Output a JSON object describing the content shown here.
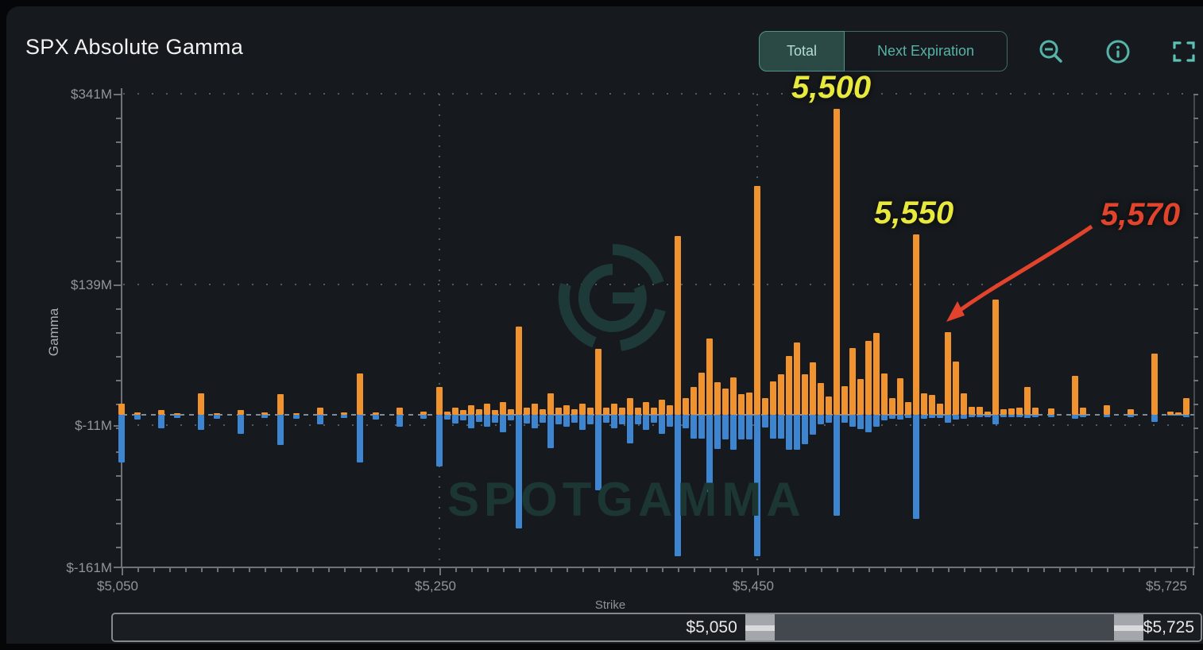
{
  "header": {
    "title": "SPX Absolute Gamma",
    "buttons": [
      {
        "label": "Total",
        "active": true
      },
      {
        "label": "Next Expiration",
        "active": false
      }
    ],
    "icons": [
      "zoom-out-icon",
      "info-icon",
      "fullscreen-icon"
    ],
    "accent_color": "#57b3a7"
  },
  "chart_data": {
    "type": "bar",
    "title": "SPX Absolute Gamma",
    "xlabel": "Strike",
    "ylabel": "Gamma",
    "xlim": [
      5050,
      5725
    ],
    "ylim": [
      -161,
      341
    ],
    "y_ticks": [
      "$341M",
      "$139M",
      "$-11M",
      "$-161M"
    ],
    "y_tick_values": [
      341,
      139,
      -11,
      -161
    ],
    "x_ticks": [
      "$5,050",
      "$5,250",
      "$5,450",
      "$5,725"
    ],
    "x_tick_values": [
      5050,
      5250,
      5450,
      5725
    ],
    "grid": "dotted, gridlines at $341M/$139M/$-11M and at strikes 5250/5450, dashed zero line",
    "legend_position": "none",
    "watermark": "SPOTGAMMA",
    "series": [
      {
        "name": "positive-gamma",
        "color": "#f0932f"
      },
      {
        "name": "negative-gamma",
        "color": "#3d84d1"
      }
    ],
    "annotations": [
      {
        "text": "5,500",
        "color": "#e8e93d",
        "strike": 5500
      },
      {
        "text": "5,550",
        "color": "#e8e93d",
        "strike": 5550
      },
      {
        "text": "5,570",
        "color": "#e2432c",
        "strike": 5570,
        "arrow": true
      }
    ],
    "bars": [
      {
        "s": 5050,
        "c": 12,
        "p": -50
      },
      {
        "s": 5060,
        "c": 3,
        "p": -5
      },
      {
        "s": 5075,
        "c": 5,
        "p": -14
      },
      {
        "s": 5085,
        "c": 2,
        "p": -3
      },
      {
        "s": 5100,
        "c": 23,
        "p": -16
      },
      {
        "s": 5110,
        "c": 2,
        "p": -4
      },
      {
        "s": 5125,
        "c": 5,
        "p": -20
      },
      {
        "s": 5140,
        "c": 3,
        "p": -3
      },
      {
        "s": 5150,
        "c": 22,
        "p": -32
      },
      {
        "s": 5160,
        "c": 2,
        "p": -4
      },
      {
        "s": 5175,
        "c": 8,
        "p": -10
      },
      {
        "s": 5190,
        "c": 3,
        "p": -3
      },
      {
        "s": 5200,
        "c": 44,
        "p": -50
      },
      {
        "s": 5210,
        "c": 3,
        "p": -5
      },
      {
        "s": 5225,
        "c": 8,
        "p": -12
      },
      {
        "s": 5240,
        "c": 4,
        "p": -4
      },
      {
        "s": 5250,
        "c": 30,
        "p": -55
      },
      {
        "s": 5255,
        "c": 4,
        "p": -5
      },
      {
        "s": 5260,
        "c": 8,
        "p": -9
      },
      {
        "s": 5265,
        "c": 5,
        "p": -6
      },
      {
        "s": 5270,
        "c": 10,
        "p": -14
      },
      {
        "s": 5275,
        "c": 6,
        "p": -7
      },
      {
        "s": 5280,
        "c": 12,
        "p": -12
      },
      {
        "s": 5285,
        "c": 5,
        "p": -8
      },
      {
        "s": 5290,
        "c": 14,
        "p": -18
      },
      {
        "s": 5295,
        "c": 6,
        "p": -6
      },
      {
        "s": 5300,
        "c": 94,
        "p": -120
      },
      {
        "s": 5305,
        "c": 8,
        "p": -9
      },
      {
        "s": 5310,
        "c": 12,
        "p": -14
      },
      {
        "s": 5315,
        "c": 6,
        "p": -8
      },
      {
        "s": 5320,
        "c": 23,
        "p": -35
      },
      {
        "s": 5325,
        "c": 8,
        "p": -10
      },
      {
        "s": 5330,
        "c": 10,
        "p": -12
      },
      {
        "s": 5335,
        "c": 6,
        "p": -8
      },
      {
        "s": 5340,
        "c": 12,
        "p": -16
      },
      {
        "s": 5345,
        "c": 8,
        "p": -10
      },
      {
        "s": 5350,
        "c": 70,
        "p": -80
      },
      {
        "s": 5355,
        "c": 8,
        "p": -8
      },
      {
        "s": 5360,
        "c": 12,
        "p": -14
      },
      {
        "s": 5365,
        "c": 8,
        "p": -10
      },
      {
        "s": 5370,
        "c": 18,
        "p": -30
      },
      {
        "s": 5375,
        "c": 8,
        "p": -10
      },
      {
        "s": 5380,
        "c": 14,
        "p": -16
      },
      {
        "s": 5385,
        "c": 8,
        "p": -8
      },
      {
        "s": 5390,
        "c": 16,
        "p": -20
      },
      {
        "s": 5395,
        "c": 10,
        "p": -12
      },
      {
        "s": 5400,
        "c": 190,
        "p": -150
      },
      {
        "s": 5405,
        "c": 18,
        "p": -14
      },
      {
        "s": 5410,
        "c": 30,
        "p": -25
      },
      {
        "s": 5415,
        "c": 45,
        "p": -25
      },
      {
        "s": 5420,
        "c": 81,
        "p": -82
      },
      {
        "s": 5425,
        "c": 35,
        "p": -36
      },
      {
        "s": 5430,
        "c": 28,
        "p": -26
      },
      {
        "s": 5435,
        "c": 40,
        "p": -37
      },
      {
        "s": 5440,
        "c": 22,
        "p": -26
      },
      {
        "s": 5445,
        "c": 24,
        "p": -26
      },
      {
        "s": 5450,
        "c": 243,
        "p": -150
      },
      {
        "s": 5455,
        "c": 18,
        "p": -13
      },
      {
        "s": 5460,
        "c": 36,
        "p": -25
      },
      {
        "s": 5465,
        "c": 43,
        "p": -25
      },
      {
        "s": 5470,
        "c": 63,
        "p": -37
      },
      {
        "s": 5475,
        "c": 77,
        "p": -37
      },
      {
        "s": 5480,
        "c": 43,
        "p": -31
      },
      {
        "s": 5485,
        "c": 56,
        "p": -21
      },
      {
        "s": 5490,
        "c": 34,
        "p": -10
      },
      {
        "s": 5495,
        "c": 20,
        "p": -8
      },
      {
        "s": 5500,
        "c": 325,
        "p": -107
      },
      {
        "s": 5505,
        "c": 31,
        "p": -8
      },
      {
        "s": 5510,
        "c": 71,
        "p": -12
      },
      {
        "s": 5515,
        "c": 38,
        "p": -15
      },
      {
        "s": 5520,
        "c": 79,
        "p": -18
      },
      {
        "s": 5525,
        "c": 87,
        "p": -12
      },
      {
        "s": 5530,
        "c": 44,
        "p": -6
      },
      {
        "s": 5535,
        "c": 18,
        "p": -4
      },
      {
        "s": 5540,
        "c": 39,
        "p": -5
      },
      {
        "s": 5545,
        "c": 14,
        "p": -3
      },
      {
        "s": 5550,
        "c": 192,
        "p": -110
      },
      {
        "s": 5555,
        "c": 23,
        "p": -4
      },
      {
        "s": 5560,
        "c": 21,
        "p": -3
      },
      {
        "s": 5565,
        "c": 12,
        "p": -3
      },
      {
        "s": 5570,
        "c": 88,
        "p": -8
      },
      {
        "s": 5575,
        "c": 57,
        "p": -5
      },
      {
        "s": 5580,
        "c": 23,
        "p": -4
      },
      {
        "s": 5585,
        "c": 9,
        "p": -2
      },
      {
        "s": 5590,
        "c": 9,
        "p": -2
      },
      {
        "s": 5595,
        "c": 4,
        "p": -2
      },
      {
        "s": 5600,
        "c": 123,
        "p": -10
      },
      {
        "s": 5605,
        "c": 6,
        "p": -2
      },
      {
        "s": 5610,
        "c": 7,
        "p": -2
      },
      {
        "s": 5615,
        "c": 8,
        "p": -2
      },
      {
        "s": 5620,
        "c": 30,
        "p": -3
      },
      {
        "s": 5625,
        "c": 8,
        "p": -2
      },
      {
        "s": 5635,
        "c": 7,
        "p": -2
      },
      {
        "s": 5650,
        "c": 42,
        "p": -4
      },
      {
        "s": 5655,
        "c": 8,
        "p": -2
      },
      {
        "s": 5670,
        "c": 10,
        "p": -2
      },
      {
        "s": 5685,
        "c": 6,
        "p": -2
      },
      {
        "s": 5700,
        "c": 65,
        "p": -7
      },
      {
        "s": 5710,
        "c": 4,
        "p": -1
      },
      {
        "s": 5715,
        "c": 3,
        "p": -1
      },
      {
        "s": 5720,
        "c": 18,
        "p": -2
      }
    ]
  },
  "slider": {
    "label": "Strike",
    "left_value": "$5,050",
    "right_value": "$5,725"
  }
}
